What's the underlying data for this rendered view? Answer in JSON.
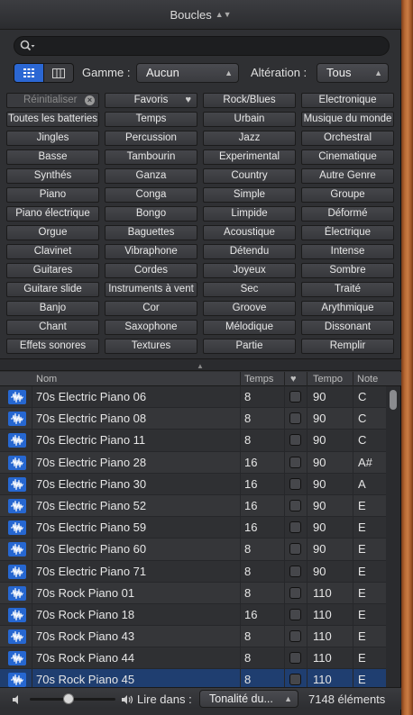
{
  "title": "Boucles",
  "search": {
    "value": "",
    "placeholder": ""
  },
  "toolbar": {
    "scale_label": "Gamme :",
    "scale_value": "Aucun",
    "signature_label": "Altération :",
    "signature_value": "Tous"
  },
  "keywords": {
    "reset_label": "Réinitialiser",
    "favorites_label": "Favoris",
    "items": [
      "Rock/Blues",
      "Electronique",
      "Toutes les batteries",
      "Temps",
      "Urbain",
      "Musique du monde",
      "Jingles",
      "Percussion",
      "Jazz",
      "Orchestral",
      "Basse",
      "Tambourin",
      "Experimental",
      "Cinematique",
      "Synthés",
      "Ganza",
      "Country",
      "Autre Genre",
      "Piano",
      "Conga",
      "Simple",
      "Groupe",
      "Piano électrique",
      "Bongo",
      "Limpide",
      "Déformé",
      "Orgue",
      "Baguettes",
      "Acoustique",
      "Électrique",
      "Clavinet",
      "Vibraphone",
      "Détendu",
      "Intense",
      "Guitares",
      "Cordes",
      "Joyeux",
      "Sombre",
      "Guitare slide",
      "Instruments à vent",
      "Sec",
      "Traité",
      "Banjo",
      "Cor",
      "Groove",
      "Arythmique",
      "Chant",
      "Saxophone",
      "Mélodique",
      "Dissonant",
      "Effets sonores",
      "Textures",
      "Partie",
      "Remplir"
    ]
  },
  "table": {
    "headers": {
      "name": "Nom",
      "beats": "Temps",
      "fav": "♥",
      "tempo": "Tempo",
      "key": "Note"
    },
    "rows": [
      {
        "name": "70s Electric Piano 06",
        "beats": "8",
        "tempo": "90",
        "key": "C"
      },
      {
        "name": "70s Electric Piano 08",
        "beats": "8",
        "tempo": "90",
        "key": "C"
      },
      {
        "name": "70s Electric Piano 11",
        "beats": "8",
        "tempo": "90",
        "key": "C"
      },
      {
        "name": "70s Electric Piano 28",
        "beats": "16",
        "tempo": "90",
        "key": "A#"
      },
      {
        "name": "70s Electric Piano 30",
        "beats": "16",
        "tempo": "90",
        "key": "A"
      },
      {
        "name": "70s Electric Piano 52",
        "beats": "16",
        "tempo": "90",
        "key": "E"
      },
      {
        "name": "70s Electric Piano 59",
        "beats": "16",
        "tempo": "90",
        "key": "E"
      },
      {
        "name": "70s Electric Piano 60",
        "beats": "8",
        "tempo": "90",
        "key": "E"
      },
      {
        "name": "70s Electric Piano 71",
        "beats": "8",
        "tempo": "90",
        "key": "E"
      },
      {
        "name": "70s Rock Piano 01",
        "beats": "8",
        "tempo": "110",
        "key": "E"
      },
      {
        "name": "70s Rock Piano 18",
        "beats": "16",
        "tempo": "110",
        "key": "E"
      },
      {
        "name": "70s Rock Piano 43",
        "beats": "8",
        "tempo": "110",
        "key": "E"
      },
      {
        "name": "70s Rock Piano 44",
        "beats": "8",
        "tempo": "110",
        "key": "E"
      },
      {
        "name": "70s Rock Piano 45",
        "beats": "8",
        "tempo": "110",
        "key": "E"
      }
    ]
  },
  "footer": {
    "play_in_label": "Lire dans :",
    "play_in_value": "Tonalité du...",
    "count": "7148 éléments",
    "volume_level": 0.45
  },
  "colors": {
    "accent": "#2b67d3",
    "selected_row": "#1f3e70"
  }
}
